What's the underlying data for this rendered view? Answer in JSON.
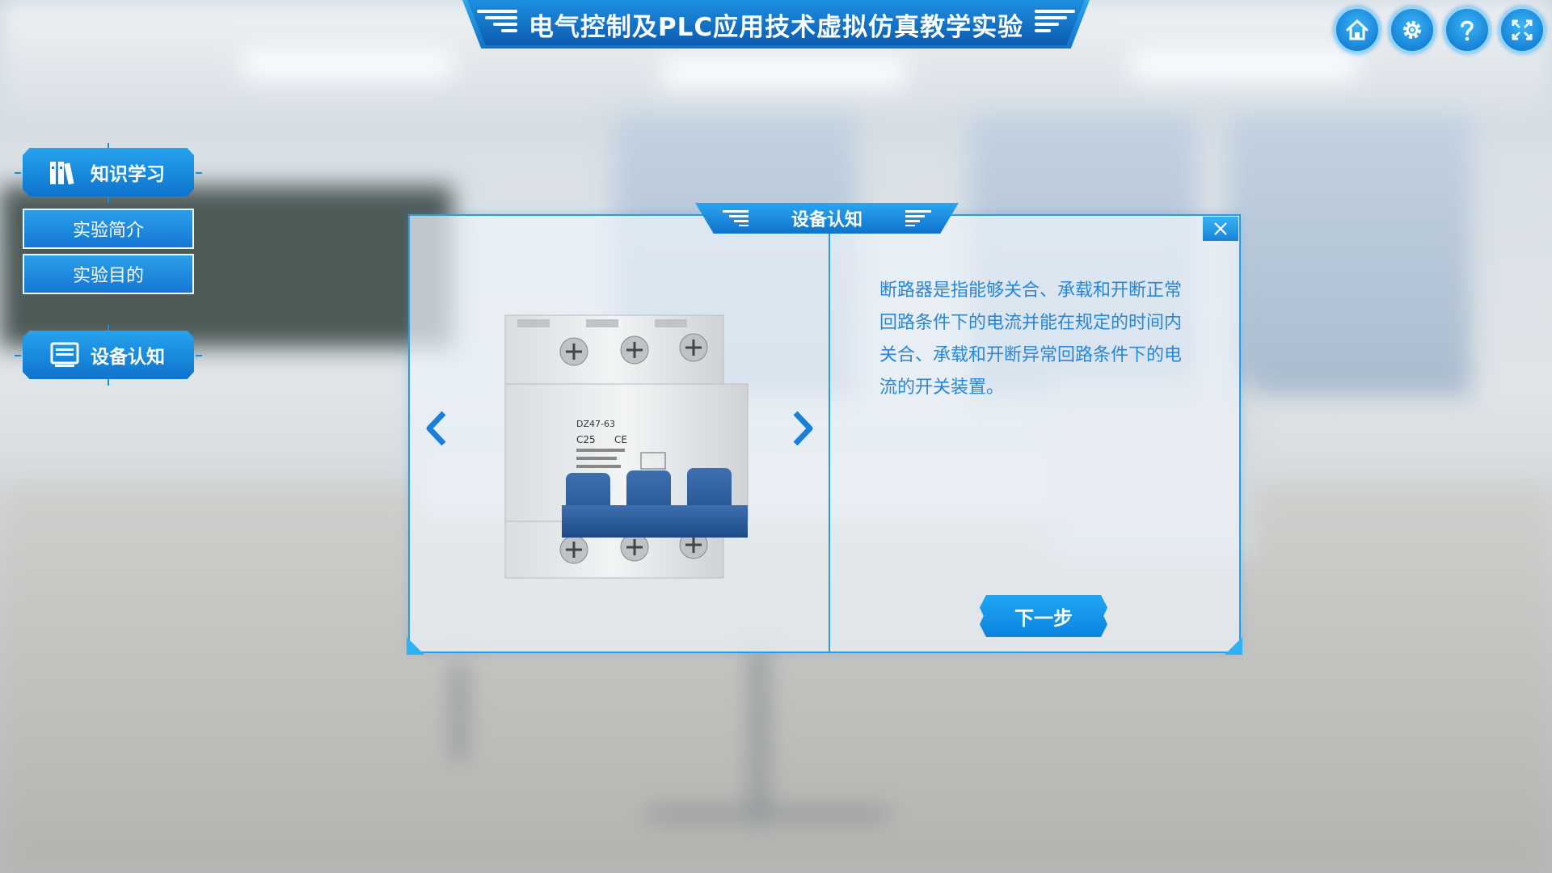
{
  "app": {
    "title": "电气控制及PLC应用技术虚拟仿真教学实验"
  },
  "top_buttons": [
    {
      "icon": "home-icon"
    },
    {
      "icon": "gear-icon"
    },
    {
      "icon": "help-icon"
    },
    {
      "icon": "fullscreen-icon"
    }
  ],
  "sidebar": {
    "knowledge": {
      "label": "知识学习",
      "icon": "books-icon"
    },
    "items": [
      {
        "label": "实验简介"
      },
      {
        "label": "实验目的"
      }
    ],
    "device": {
      "label": "设备认知",
      "icon": "monitor-icon"
    }
  },
  "dialog": {
    "title": "设备认知",
    "description": "断路器是指能够关合、承载和开断正常回路条件下的电流并能在规定的时间内关合、承载和开断异常回路条件下的电流的开关装置。",
    "next_label": "下一步",
    "device_image": {
      "model_label": "DZ47-63",
      "rating_label": "C25",
      "certification": "CE"
    }
  },
  "colors": {
    "accent": "#1a8fe3",
    "text_blue": "#2a86d6",
    "button_blue": "#0e78d4"
  }
}
